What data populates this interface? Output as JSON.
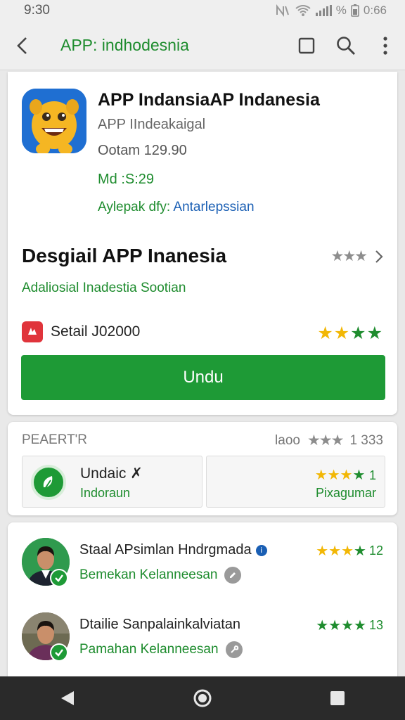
{
  "status_bar": {
    "time": "9:30",
    "battery_text": "%",
    "clock_right": "0:66"
  },
  "app_bar": {
    "title": "APP: indhodesnia",
    "icons": [
      "back-arrow-icon",
      "square-icon",
      "search-icon",
      "more-vert-icon"
    ]
  },
  "app": {
    "title": "APP IndansiaAP Indanesia",
    "developer": "APP IIndeakaigal",
    "version": "Ootam 129.90",
    "size": "Md :S:29",
    "offer_label": "Aylepak dfy:",
    "offer_value": "Antarlepssian"
  },
  "section": {
    "title": "Desgiail APP Inanesia",
    "subtitle": "Adaliosial Inadestia Sootian",
    "rating_stars": "★★★",
    "setail_text": "Setail J02000",
    "setail_stars": "★★★★"
  },
  "install_button": "Undu",
  "rating_card": {
    "header": "PEAERT'R",
    "summary_label": "laoo",
    "summary_stars": "★★★",
    "summary_count": "1 333",
    "tile_left": {
      "title": "Undaic ✗",
      "subtitle": "Indoraun"
    },
    "tile_right": {
      "stars": "★★★★",
      "count": "1",
      "subtitle": "Pixagumar"
    }
  },
  "reviews": [
    {
      "name": "Staal APsimlan Hndrgmada",
      "subtitle": "Bemekan Kelanneesan",
      "stars": "★★★★",
      "count": "12"
    },
    {
      "name": "Dtailie Sanpalainkalviatan",
      "subtitle": "Pamahan Kelanneesan",
      "stars": "★★★★",
      "count": "13"
    }
  ],
  "colors": {
    "accent_green": "#1e9a36",
    "link_blue": "#1a5fb4",
    "star_yellow": "#f2b705"
  }
}
